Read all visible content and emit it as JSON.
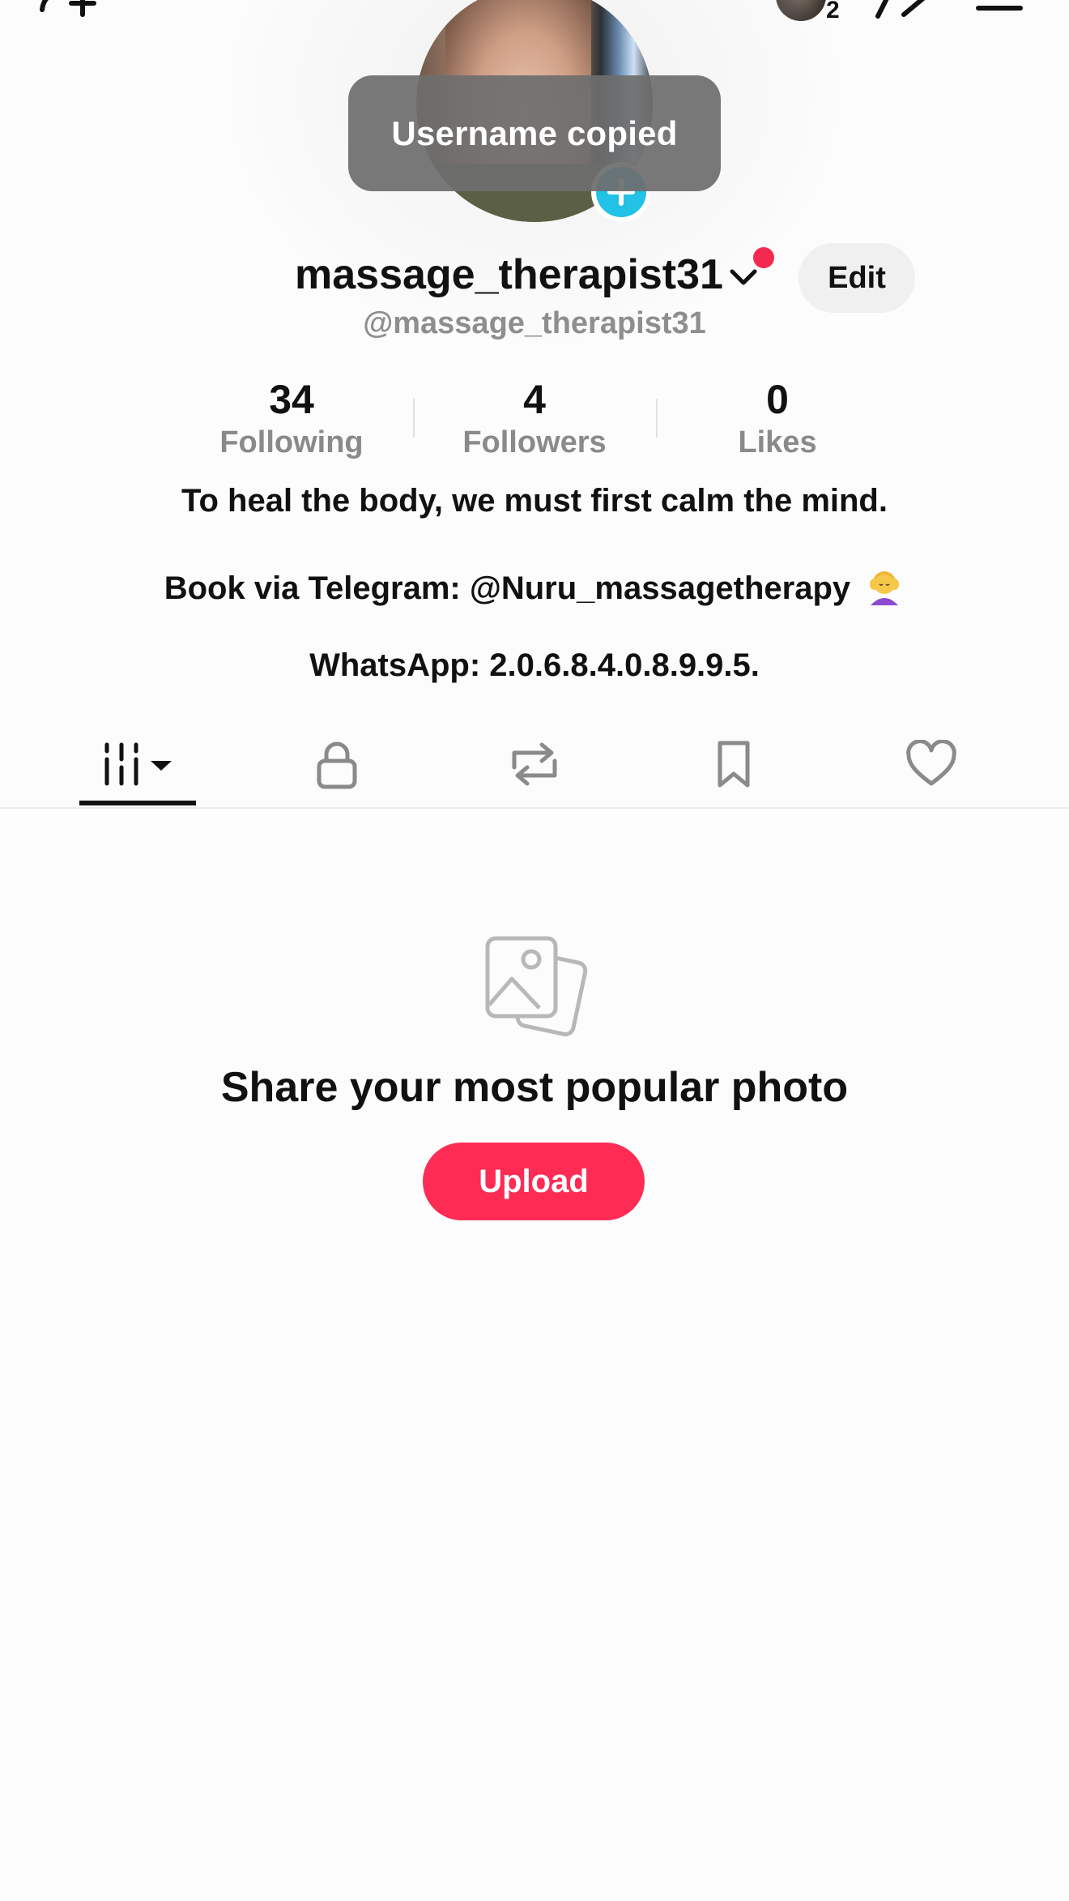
{
  "top_bar": {
    "following_avatar_count": "2"
  },
  "toast": {
    "message": "Username copied"
  },
  "profile": {
    "display_name": "massage_therapist31",
    "handle": "@massage_therapist31",
    "edit_label": "Edit"
  },
  "stats": [
    {
      "value": "34",
      "label": "Following"
    },
    {
      "value": "4",
      "label": "Followers"
    },
    {
      "value": "0",
      "label": "Likes"
    }
  ],
  "bio": {
    "line1": "To heal the body, we must first calm the mind.",
    "line2": "Book via Telegram: @Nuru_massagetherapy",
    "line2_emoji": "woman-getting-massage-emoji",
    "line3": "WhatsApp: 2.0.6.8.4.0.8.9.9.5."
  },
  "tabs": [
    {
      "name": "videos-grid-icon",
      "active": true
    },
    {
      "name": "lock-icon",
      "active": false
    },
    {
      "name": "repost-icon",
      "active": false
    },
    {
      "name": "bookmark-icon",
      "active": false
    },
    {
      "name": "heart-icon",
      "active": false
    }
  ],
  "empty_state": {
    "icon": "photos-icon",
    "title": "Share your most popular photo",
    "button_label": "Upload"
  },
  "colors": {
    "accent": "#fe2c55",
    "avatar_add": "#22c1e6",
    "notification_dot": "#f4294f",
    "secondary_text": "#8e8e8e"
  }
}
